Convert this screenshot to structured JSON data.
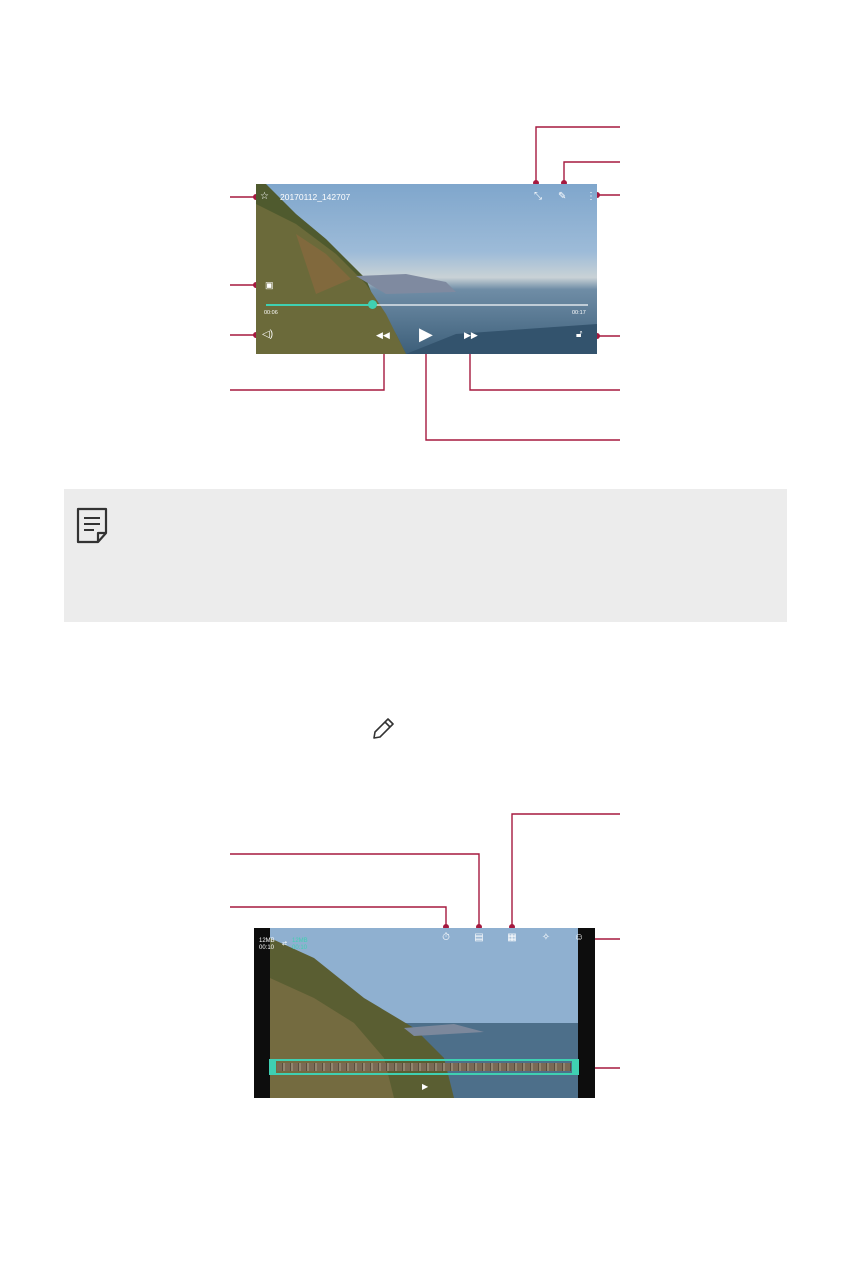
{
  "player": {
    "filename": "20170112_142707",
    "time_current": "00:06",
    "time_total": "00:17",
    "progress": 0.33,
    "icons": [
      "star-outline-icon",
      "capture-icon",
      "volume-icon",
      "rewind-icon",
      "play-icon",
      "fast-forward-icon",
      "lock-icon",
      "shrink-icon",
      "edit-pencil-icon",
      "more-options-icon"
    ]
  },
  "editor": {
    "orig_size": "12MB",
    "orig_time": "00:10",
    "new_size": "12MB",
    "new_time": "00:10",
    "tools": [
      {
        "icon": "timer-icon"
      },
      {
        "icon": "subtitle-icon"
      },
      {
        "icon": "grid-icon"
      },
      {
        "icon": "magic-wand-icon"
      },
      {
        "icon": "face-icon"
      }
    ]
  },
  "colors": {
    "callout": "#a5193f",
    "accent": "#3fd0b2",
    "note_bg": "#ececec"
  }
}
